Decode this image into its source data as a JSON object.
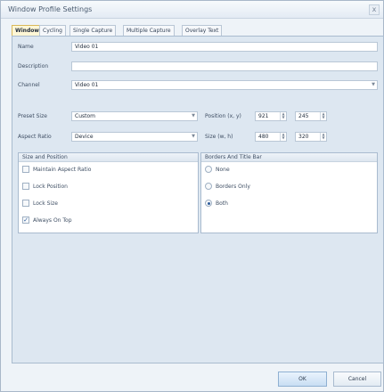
{
  "window": {
    "title": "Window Profile Settings",
    "close_label": "x"
  },
  "tabs": [
    {
      "label": "Window",
      "active": true
    },
    {
      "label": "Cycling",
      "active": false
    },
    {
      "label": "Single Capture",
      "active": false
    },
    {
      "label": "Multiple Capture",
      "active": false
    },
    {
      "label": "Overlay Text",
      "active": false
    }
  ],
  "form": {
    "name_label": "Name",
    "name_value": "Video 01",
    "description_label": "Description",
    "description_value": "",
    "channel_label": "Channel",
    "channel_value": "Video 01",
    "preset_size_label": "Preset Size",
    "preset_size_value": "Custom",
    "aspect_ratio_label": "Aspect Ratio",
    "aspect_ratio_value": "Device",
    "position_label": "Position (x, y)",
    "position_x": "921",
    "position_y": "245",
    "size_label": "Size (w, h)",
    "size_w": "480",
    "size_h": "320"
  },
  "size_position": {
    "header": "Size and Position",
    "options": [
      {
        "label": "Maintain Aspect Ratio",
        "checked": false
      },
      {
        "label": "Lock Position",
        "checked": false
      },
      {
        "label": "Lock Size",
        "checked": false
      },
      {
        "label": "Always On Top",
        "checked": true
      }
    ]
  },
  "borders": {
    "header": "Borders And Title Bar",
    "options": [
      {
        "label": "None",
        "selected": false
      },
      {
        "label": "Borders Only",
        "selected": false
      },
      {
        "label": "Both",
        "selected": true
      }
    ]
  },
  "buttons": {
    "ok": "OK",
    "cancel": "Cancel"
  },
  "icons": {
    "dropdown": "chevron-down-icon",
    "spin": "spin-updown-icon",
    "check": "check-icon"
  },
  "colors": {
    "active_tab": "#fff7d6",
    "panel": "#dde7f1",
    "accent": "#2c5a9a"
  }
}
